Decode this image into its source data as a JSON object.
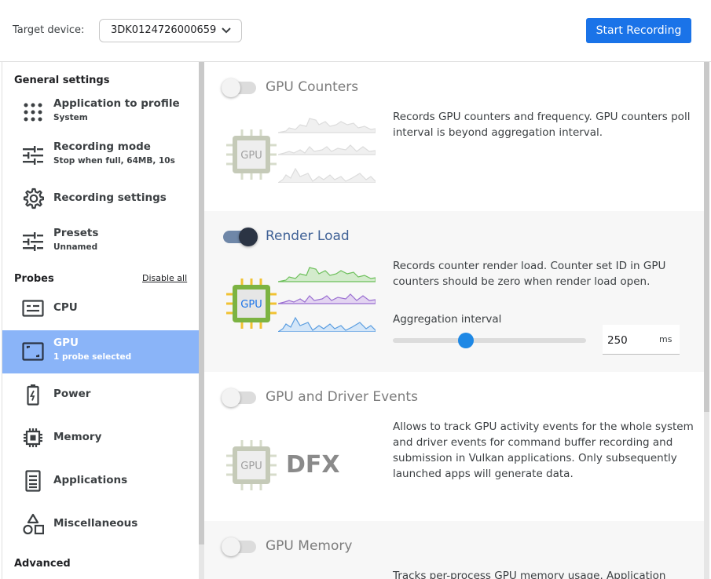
{
  "header": {
    "target_label": "Target device:",
    "device": "3DK0124726000659",
    "start_button": "Start Recording",
    "accent": "#1a73e8"
  },
  "sidebar": {
    "general_title": "General settings",
    "general_items": [
      {
        "icon": "grid-dots-icon",
        "title": "Application to profile",
        "subtitle": "System"
      },
      {
        "icon": "tune-sliders-icon",
        "title": "Recording mode",
        "subtitle": "Stop when full, 64MB, 10s"
      },
      {
        "icon": "gear-icon",
        "title": "Recording settings",
        "subtitle": ""
      },
      {
        "icon": "tune-sliders-icon",
        "title": "Presets",
        "subtitle": "Unnamed"
      }
    ],
    "probes_title": "Probes",
    "disable_all": "Disable all",
    "probe_items": [
      {
        "icon": "cpu-icon",
        "title": "CPU",
        "subtitle": ""
      },
      {
        "icon": "gpu-icon",
        "title": "GPU",
        "subtitle": "1 probe selected",
        "selected": true
      },
      {
        "icon": "battery-icon",
        "title": "Power",
        "subtitle": ""
      },
      {
        "icon": "memory-chip-icon",
        "title": "Memory",
        "subtitle": ""
      },
      {
        "icon": "document-icon",
        "title": "Applications",
        "subtitle": ""
      },
      {
        "icon": "shapes-icon",
        "title": "Miscellaneous",
        "subtitle": ""
      }
    ],
    "advanced_title": "Advanced",
    "selected_color": "#8ab4f8"
  },
  "probes": [
    {
      "title": "GPU Counters",
      "enabled": false,
      "chip_label": "GPU",
      "description": "Records GPU counters and frequency. GPU counters poll interval is beyond aggregation interval."
    },
    {
      "title": "Render Load",
      "enabled": true,
      "chip_label": "GPU",
      "description": "Records counter render load. Counter set ID in GPU counters should be zero when render load open.",
      "aggregation_label": "Aggregation interval",
      "aggregation_value": "250",
      "aggregation_unit": "ms",
      "slider_fraction": 0.38
    },
    {
      "title": "GPU and Driver Events",
      "enabled": false,
      "chip_label": "GPU",
      "logo_text": "DFX",
      "description": "Allows to track GPU activity events for the whole system and driver events for command buffer recording and submission in Vulkan applications. Only subsequently launched apps will generate data."
    },
    {
      "title": "GPU Memory",
      "enabled": false,
      "description": "Tracks per-process GPU memory usage. Application"
    }
  ]
}
